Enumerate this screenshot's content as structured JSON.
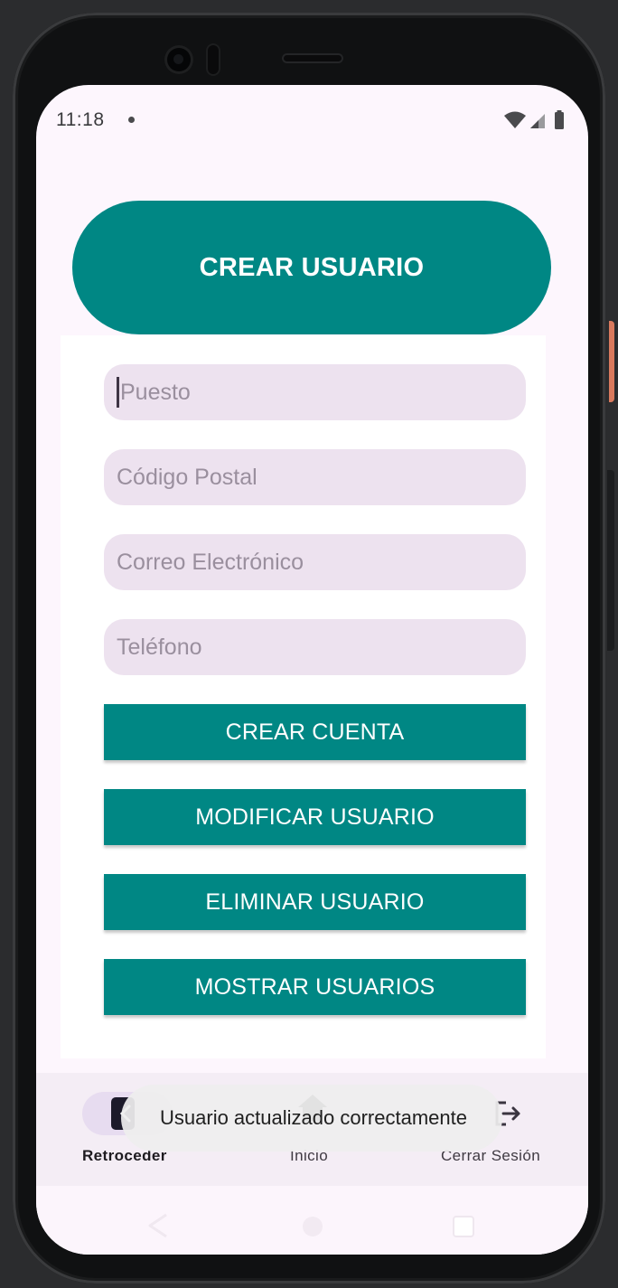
{
  "status_bar": {
    "time": "11:18"
  },
  "header": {
    "title": "CREAR USUARIO"
  },
  "form": {
    "fields": [
      {
        "placeholder": "Puesto"
      },
      {
        "placeholder": "Código Postal"
      },
      {
        "placeholder": "Correo Electrónico"
      },
      {
        "placeholder": "Teléfono"
      }
    ],
    "buttons": [
      {
        "label": "CREAR CUENTA"
      },
      {
        "label": "MODIFICAR USUARIO"
      },
      {
        "label": "ELIMINAR USUARIO"
      },
      {
        "label": "MOSTRAR USUARIOS"
      }
    ]
  },
  "bottom_nav": {
    "items": [
      {
        "label": "Retroceder",
        "icon": "back-icon",
        "active": true
      },
      {
        "label": "Inicio",
        "icon": "home-icon",
        "active": false
      },
      {
        "label": "Cerrar Sesión",
        "icon": "logout-icon",
        "active": false
      }
    ]
  },
  "toast": {
    "message": "Usuario actualizado correctamente"
  },
  "colors": {
    "primary": "#008784",
    "field_bg": "#ede2ef",
    "screen_bg": "#fdf6fd"
  }
}
